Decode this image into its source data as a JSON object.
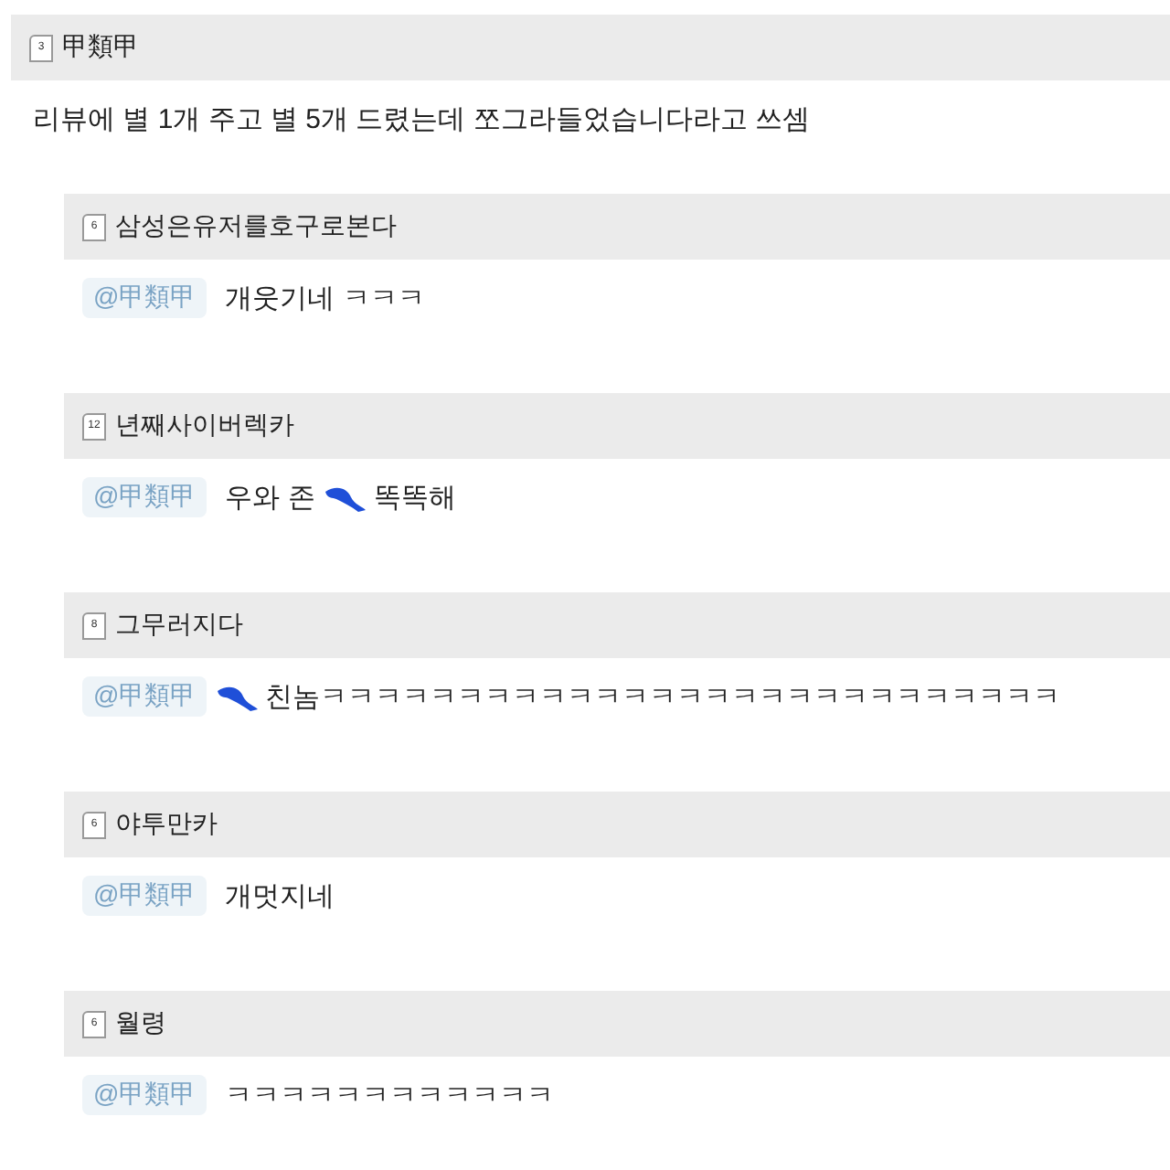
{
  "post": {
    "author": "甲類甲",
    "level": "3",
    "text": "리뷰에 별 1개 주고 별 5개 드렸는데 쪼그라들었습니다라고 쓰셈"
  },
  "replies": [
    {
      "author": "삼성은유저를호구로본다",
      "level": "6",
      "mention": "@甲類甲",
      "text_before": "개웃기네 ㅋㅋㅋ",
      "censored": false
    },
    {
      "author": "년째사이버렉카",
      "level": "12",
      "mention": "@甲類甲",
      "text_before": "우와 존",
      "censored": true,
      "text_after": "똑똑해"
    },
    {
      "author": "그무러지다",
      "level": "8",
      "mention": "@甲類甲",
      "censored": true,
      "text_after": "친놈ㅋㅋㅋㅋㅋㅋㅋㅋㅋㅋㅋㅋㅋㅋㅋㅋㅋㅋㅋㅋㅋㅋㅋㅋㅋㅋㅋ"
    },
    {
      "author": "야투만카",
      "level": "6",
      "mention": "@甲類甲",
      "text_before": "개멋지네",
      "censored": false
    },
    {
      "author": "월령",
      "level": "6",
      "mention": "@甲類甲",
      "text_before": "ㅋㅋㅋㅋㅋㅋㅋㅋㅋㅋㅋㅋ",
      "censored": false
    }
  ]
}
